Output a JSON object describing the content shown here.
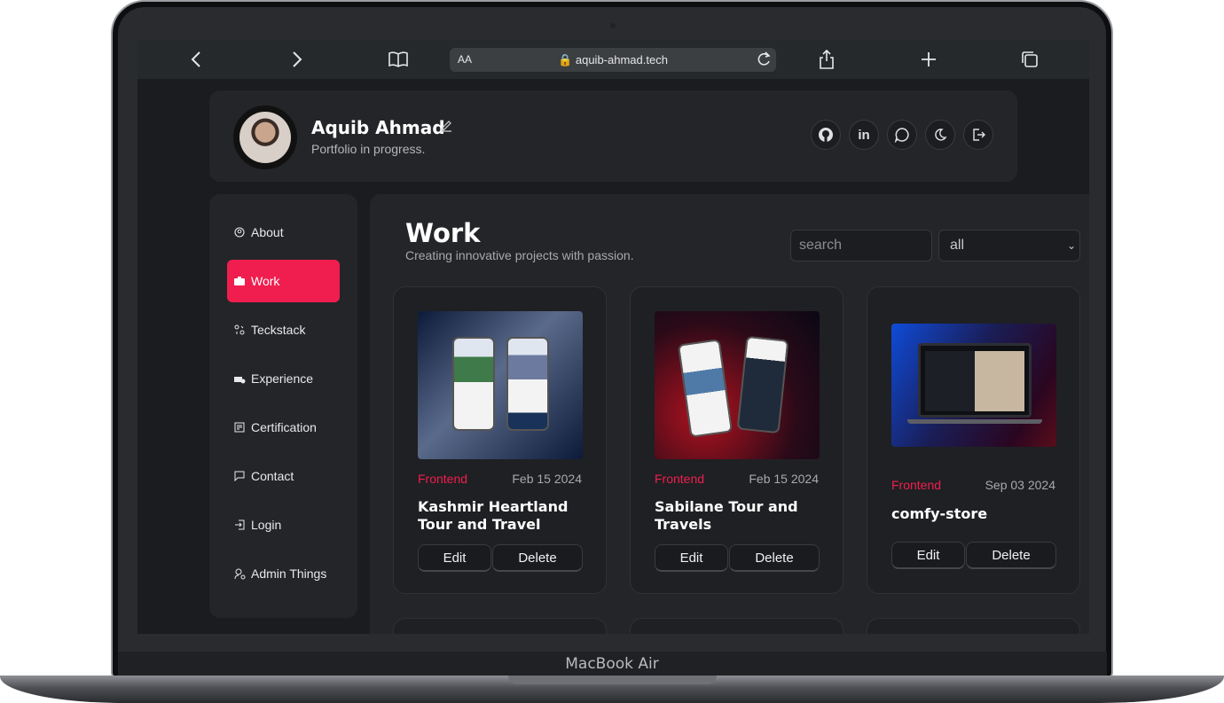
{
  "device": {
    "model_label": "MacBook Air"
  },
  "browser": {
    "text_size_label": "AA",
    "url": "aquib-ahmad.tech"
  },
  "profile": {
    "name": "Aquib Ahmad",
    "tagline": "Portfolio in progress."
  },
  "social_icons": [
    "github-icon",
    "linkedin-icon",
    "whatsapp-icon",
    "moon-icon",
    "logout-icon"
  ],
  "sidebar": {
    "items": [
      {
        "label": "About",
        "icon": "user-circle-icon",
        "active": false
      },
      {
        "label": "Work",
        "icon": "briefcase-icon",
        "active": true
      },
      {
        "label": "Teckstack",
        "icon": "stack-icon",
        "active": false
      },
      {
        "label": "Experience",
        "icon": "car-icon",
        "active": false
      },
      {
        "label": "Certification",
        "icon": "certificate-icon",
        "active": false
      },
      {
        "label": "Contact",
        "icon": "message-icon",
        "active": false
      },
      {
        "label": "Login",
        "icon": "login-icon",
        "active": false
      },
      {
        "label": "Admin Things",
        "icon": "user-gear-icon",
        "active": false
      }
    ]
  },
  "main": {
    "title": "Work",
    "subtitle": "Creating innovative projects with passion.",
    "search_placeholder": "search",
    "filter_value": "all"
  },
  "projects": [
    {
      "category": "Frontend",
      "date": "Feb 15 2024",
      "title": "Kashmir Heartland Tour and Travel",
      "edit_label": "Edit",
      "delete_label": "Delete"
    },
    {
      "category": "Frontend",
      "date": "Feb 15 2024",
      "title": "Sabilane Tour and Travels",
      "edit_label": "Edit",
      "delete_label": "Delete"
    },
    {
      "category": "Frontend",
      "date": "Sep 03 2024",
      "title": "comfy-store",
      "edit_label": "Edit",
      "delete_label": "Delete"
    }
  ],
  "colors": {
    "accent": "#f01e4f",
    "background": "#1b1c1f",
    "card": "#242528"
  }
}
